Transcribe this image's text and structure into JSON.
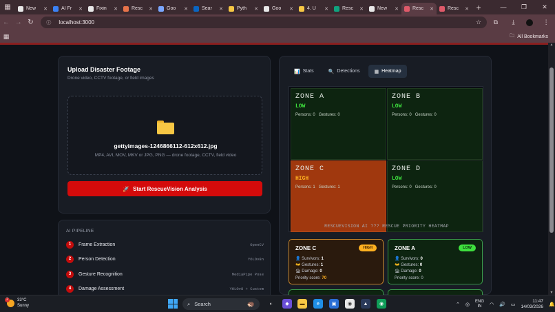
{
  "browser": {
    "tabs": [
      {
        "title": "New",
        "icon": "globe-icon",
        "color": "#e8e8e8"
      },
      {
        "title": "AI Fr",
        "icon": "d-logo-icon",
        "color": "#3b82f6"
      },
      {
        "title": "Fixin",
        "icon": "chat-icon",
        "color": "#e8e8e8"
      },
      {
        "title": "Resc",
        "icon": "asterisk-icon",
        "color": "#e8734a"
      },
      {
        "title": "Goo",
        "icon": "star-icon",
        "color": "#7aa7ff"
      },
      {
        "title": "Sear",
        "icon": "linkedin-icon",
        "color": "#0a66c2"
      },
      {
        "title": "Pyth",
        "icon": "python-icon",
        "color": "#f7c744"
      },
      {
        "title": "Goo",
        "icon": "globe-icon",
        "color": "#e8e8e8"
      },
      {
        "title": "4. U",
        "icon": "python-icon",
        "color": "#f7c744"
      },
      {
        "title": "Resc",
        "icon": "chatgpt-icon",
        "color": "#10a37f"
      },
      {
        "title": "New",
        "icon": "globe-icon",
        "color": "#e8e8e8"
      },
      {
        "title": "Resc",
        "icon": "app-icon",
        "color": "#e05a6a"
      },
      {
        "title": "Resc",
        "icon": "app-icon",
        "color": "#e05a6a"
      }
    ],
    "active_tab_index": 11,
    "url": "localhost:3000",
    "bookmarks_label": "All Bookmarks"
  },
  "upload": {
    "title": "Upload Disaster Footage",
    "subtitle": "Drone video, CCTV footage, or field images",
    "file_name": "gettyimages-1246866112-612x612.jpg",
    "file_hint": "MP4, AVI, MOV, MKV or JPG, PNG — drone footage, CCTV, field video",
    "button_label": "Start RescueVision Analysis"
  },
  "pipeline": {
    "title": "AI PIPELINE",
    "steps": [
      {
        "num": "1",
        "label": "Frame Extraction",
        "tag": "OpenCV"
      },
      {
        "num": "2",
        "label": "Person Detection",
        "tag": "YOLOv8n"
      },
      {
        "num": "3",
        "label": "Gesture Recognition",
        "tag": "MediaPipe Pose"
      },
      {
        "num": "4",
        "label": "Damage Assessment",
        "tag": "YOLOv8 + Custom"
      }
    ]
  },
  "results": {
    "tabs": [
      {
        "label": "Stats",
        "icon": "bar-chart-icon"
      },
      {
        "label": "Detections",
        "icon": "search-icon"
      },
      {
        "label": "Heatmap",
        "icon": "grid-icon"
      }
    ],
    "active_tab": "Heatmap",
    "heatmap": {
      "caption": "RESCUEVISION AI ??? RESCUE PRIORITY HEATMAP",
      "zones": [
        {
          "name": "ZONE A",
          "level": "LOW",
          "persons_label": "Persons:",
          "persons": "0",
          "gestures_label": "Gestures:",
          "gestures": "0"
        },
        {
          "name": "ZONE B",
          "level": "LOW",
          "persons_label": "Persons:",
          "persons": "0",
          "gestures_label": "Gestures:",
          "gestures": "0"
        },
        {
          "name": "ZONE C",
          "level": "HIGH",
          "persons_label": "Persons:",
          "persons": "1",
          "gestures_label": "Gestures:",
          "gestures": "1"
        },
        {
          "name": "ZONE D",
          "level": "LOW",
          "persons_label": "Persons:",
          "persons": "0",
          "gestures_label": "Gestures:",
          "gestures": "0"
        }
      ]
    },
    "zone_cards": [
      {
        "name": "ZONE C",
        "badge": "HIGH",
        "survivors_label": "Survivors:",
        "survivors": "1",
        "gestures_label": "Gestures:",
        "gestures": "1",
        "damage_label": "Damage:",
        "damage": "0",
        "score_label": "Priority score:",
        "score": "70"
      },
      {
        "name": "ZONE A",
        "badge": "LOW",
        "survivors_label": "Survivors:",
        "survivors": "0",
        "gestures_label": "Gestures:",
        "gestures": "0",
        "damage_label": "Damage:",
        "damage": "0",
        "score_label": "Priority score:",
        "score": "0"
      }
    ]
  },
  "colors": {
    "accent_red": "#d40b0b",
    "low_green": "#3ee03e",
    "high_orange": "#ffb020",
    "zone_low_bg": "#0d2410",
    "zone_high_bg": "#a0380e"
  },
  "taskbar": {
    "weather_temp": "33°C",
    "weather_desc": "Sunny",
    "weather_badge": "2",
    "search_placeholder": "Search",
    "lang_top": "ENG",
    "lang_bottom": "IN",
    "time": "11:47",
    "date": "14/03/2026"
  }
}
